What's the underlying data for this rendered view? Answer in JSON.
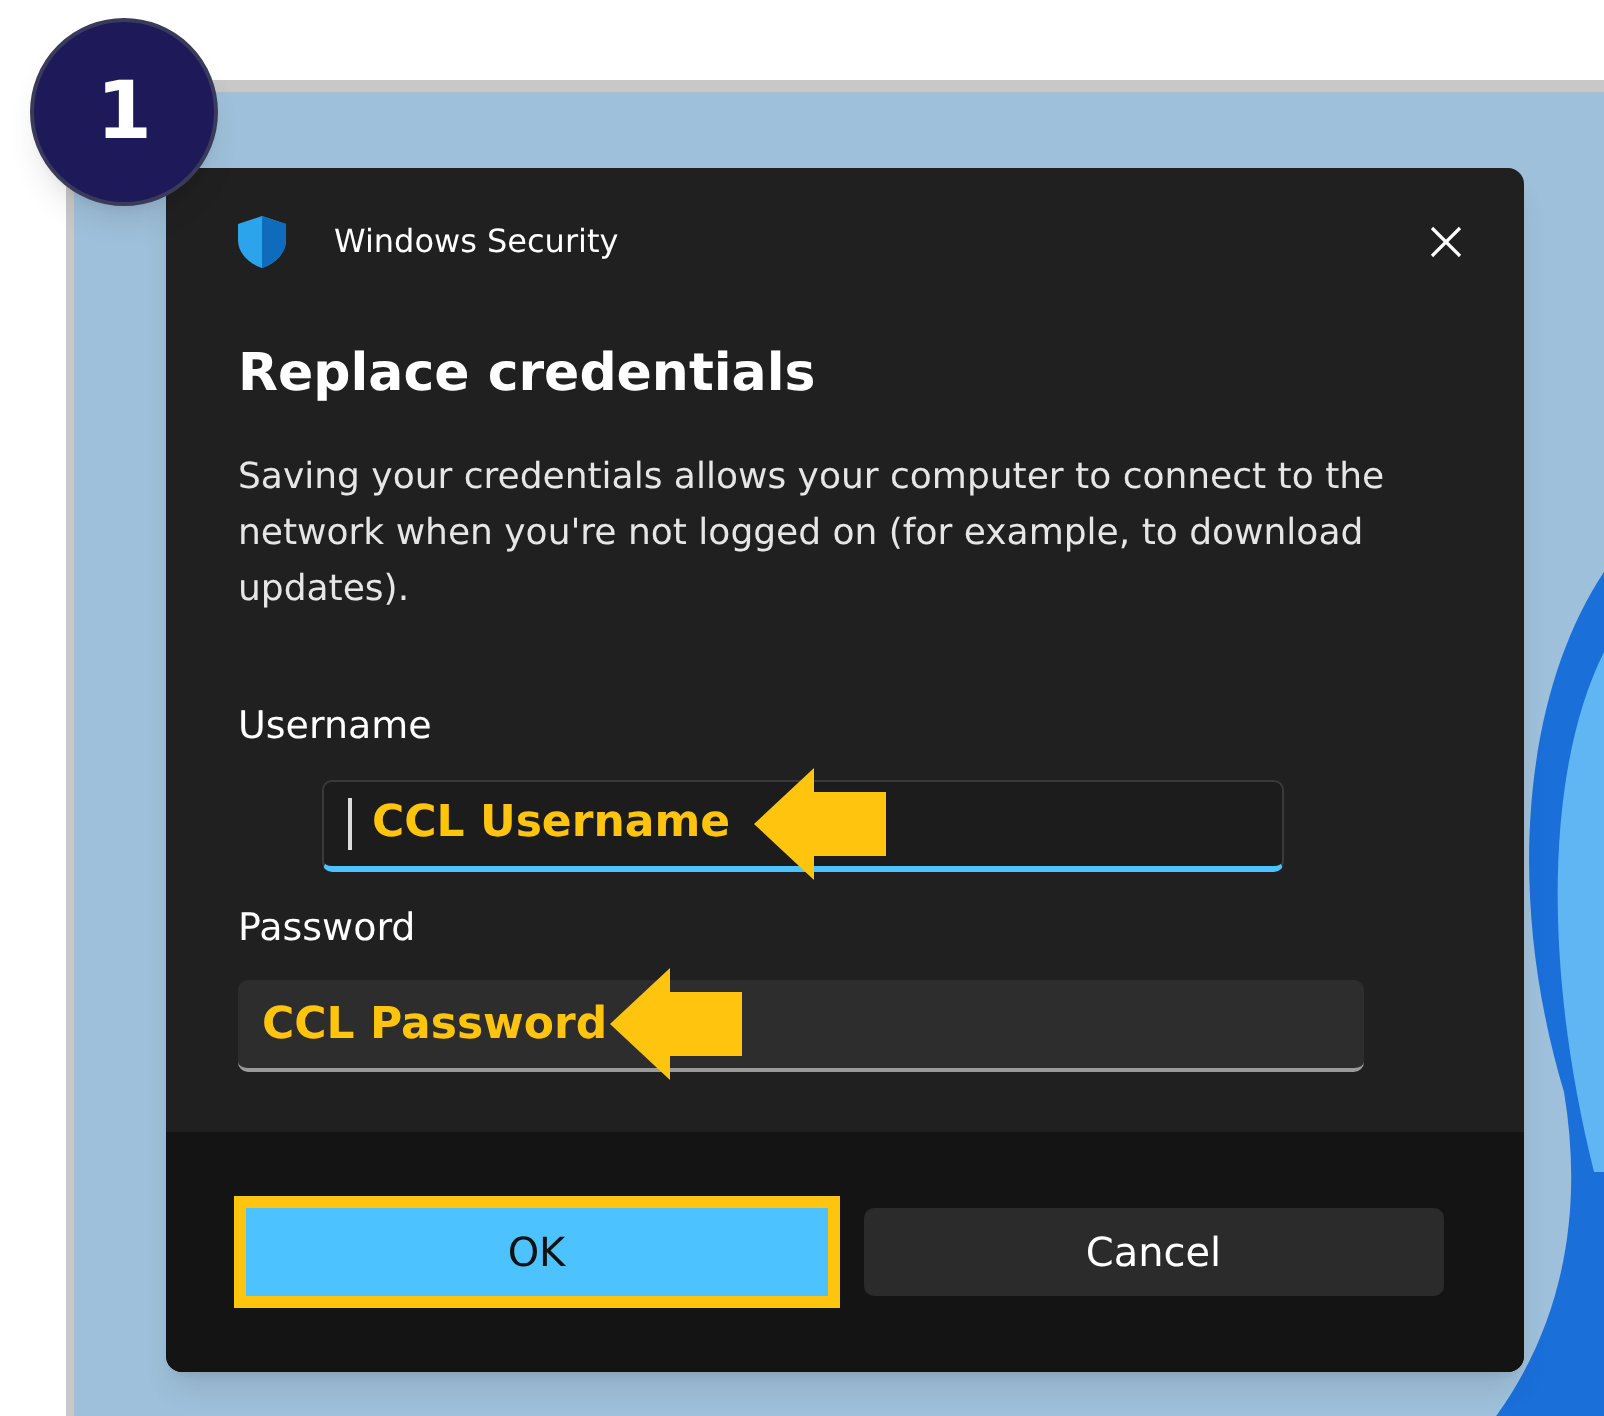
{
  "step_badge": "1",
  "window": {
    "title": "Windows Security",
    "heading": "Replace credentials",
    "description": "Saving your credentials allows your computer to connect to the network when you're not logged on (for example, to download updates)."
  },
  "fields": [
    {
      "label": "Username",
      "value": "CCL Username",
      "focused": true,
      "pointed": true
    },
    {
      "label": "Password",
      "value": "CCL Password",
      "focused": false,
      "pointed": true
    }
  ],
  "buttons": [
    {
      "label": "OK",
      "primary": true,
      "highlighted": true
    },
    {
      "label": "Cancel",
      "primary": false,
      "highlighted": false
    }
  ]
}
